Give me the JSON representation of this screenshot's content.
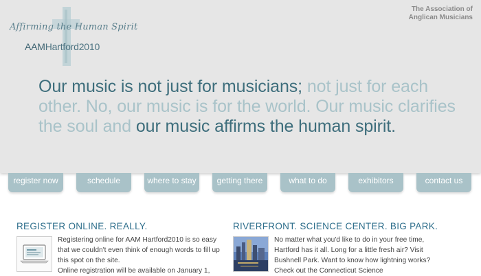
{
  "logo": {
    "script": "Affirming the Human Spirit",
    "name_bold": "AAM",
    "name_rest": "Hartford2010"
  },
  "association": {
    "line1": "The Association of",
    "line2": "Anglican Musicians"
  },
  "quote": {
    "part1": "Our music is not just for musicians;",
    "part2": " not just for each other. No, our music is for the world. Our music clarifies the soul and ",
    "part3": "our music affirms the human spirit."
  },
  "nav": {
    "items": [
      {
        "label": "register now"
      },
      {
        "label": "schedule"
      },
      {
        "label": "where to stay"
      },
      {
        "label": "getting there"
      },
      {
        "label": "what to do"
      },
      {
        "label": "exhibitors"
      },
      {
        "label": "contact us"
      }
    ]
  },
  "sections": [
    {
      "heading": "REGISTER ONLINE. REALLY.",
      "text1": "Registering online for AAM Hartford2010 is so easy that we couldn't even think of enough words to fill up this spot on the site.",
      "text2": "Online registration will be available on January 1,"
    },
    {
      "heading": "RIVERFRONT. SCIENCE CENTER. BIG PARK.",
      "text1": "No matter what you'd like to do in your free time, Hartford has it all. Long for a little fresh air? Visit Bushnell Park. Want to know how lightning works? Check out the Connecticut Science"
    }
  ],
  "colors": {
    "accent_dark": "#3e6e7c",
    "accent_light": "#a9c3c9",
    "nav_tab": "#a9c2c8",
    "heading": "#2f6f8c"
  }
}
